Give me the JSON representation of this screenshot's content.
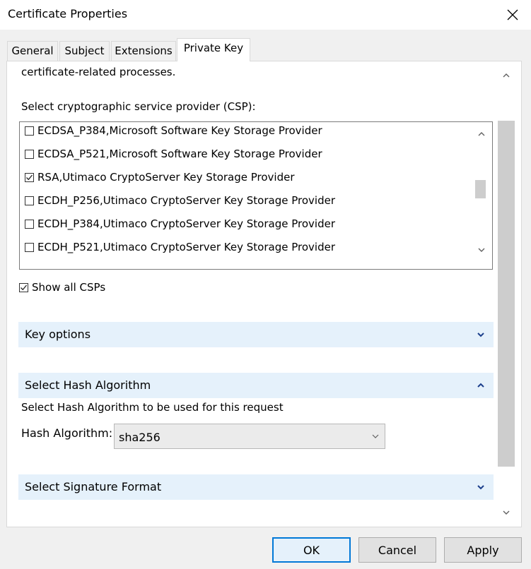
{
  "window": {
    "title": "Certificate Properties"
  },
  "tabs": [
    {
      "label": "General"
    },
    {
      "label": "Subject"
    },
    {
      "label": "Extensions"
    },
    {
      "label": "Private Key"
    }
  ],
  "panel": {
    "intro_tail": "certificate-related processes.",
    "csp_label": "Select cryptographic service provider (CSP):",
    "csp_items": [
      {
        "label": "ECDSA_P384,Microsoft Software Key Storage Provider",
        "checked": false
      },
      {
        "label": "ECDSA_P521,Microsoft Software Key Storage Provider",
        "checked": false
      },
      {
        "label": "RSA,Utimaco CryptoServer Key Storage Provider",
        "checked": true
      },
      {
        "label": "ECDH_P256,Utimaco CryptoServer Key Storage Provider",
        "checked": false
      },
      {
        "label": "ECDH_P384,Utimaco CryptoServer Key Storage Provider",
        "checked": false
      },
      {
        "label": "ECDH_P521,Utimaco CryptoServer Key Storage Provider",
        "checked": false
      }
    ],
    "show_all_csps": {
      "label": "Show all CSPs",
      "checked": true
    },
    "key_options": {
      "label": "Key options",
      "expanded": false
    },
    "hash_section": {
      "label": "Select Hash Algorithm",
      "expanded": true,
      "description": "Select Hash Algorithm to be used for this request",
      "field_label": "Hash Algorithm:",
      "value": "sha256"
    },
    "signature_format": {
      "label": "Select Signature Format",
      "expanded": false
    }
  },
  "buttons": {
    "ok": "OK",
    "cancel": "Cancel",
    "apply": "Apply"
  }
}
